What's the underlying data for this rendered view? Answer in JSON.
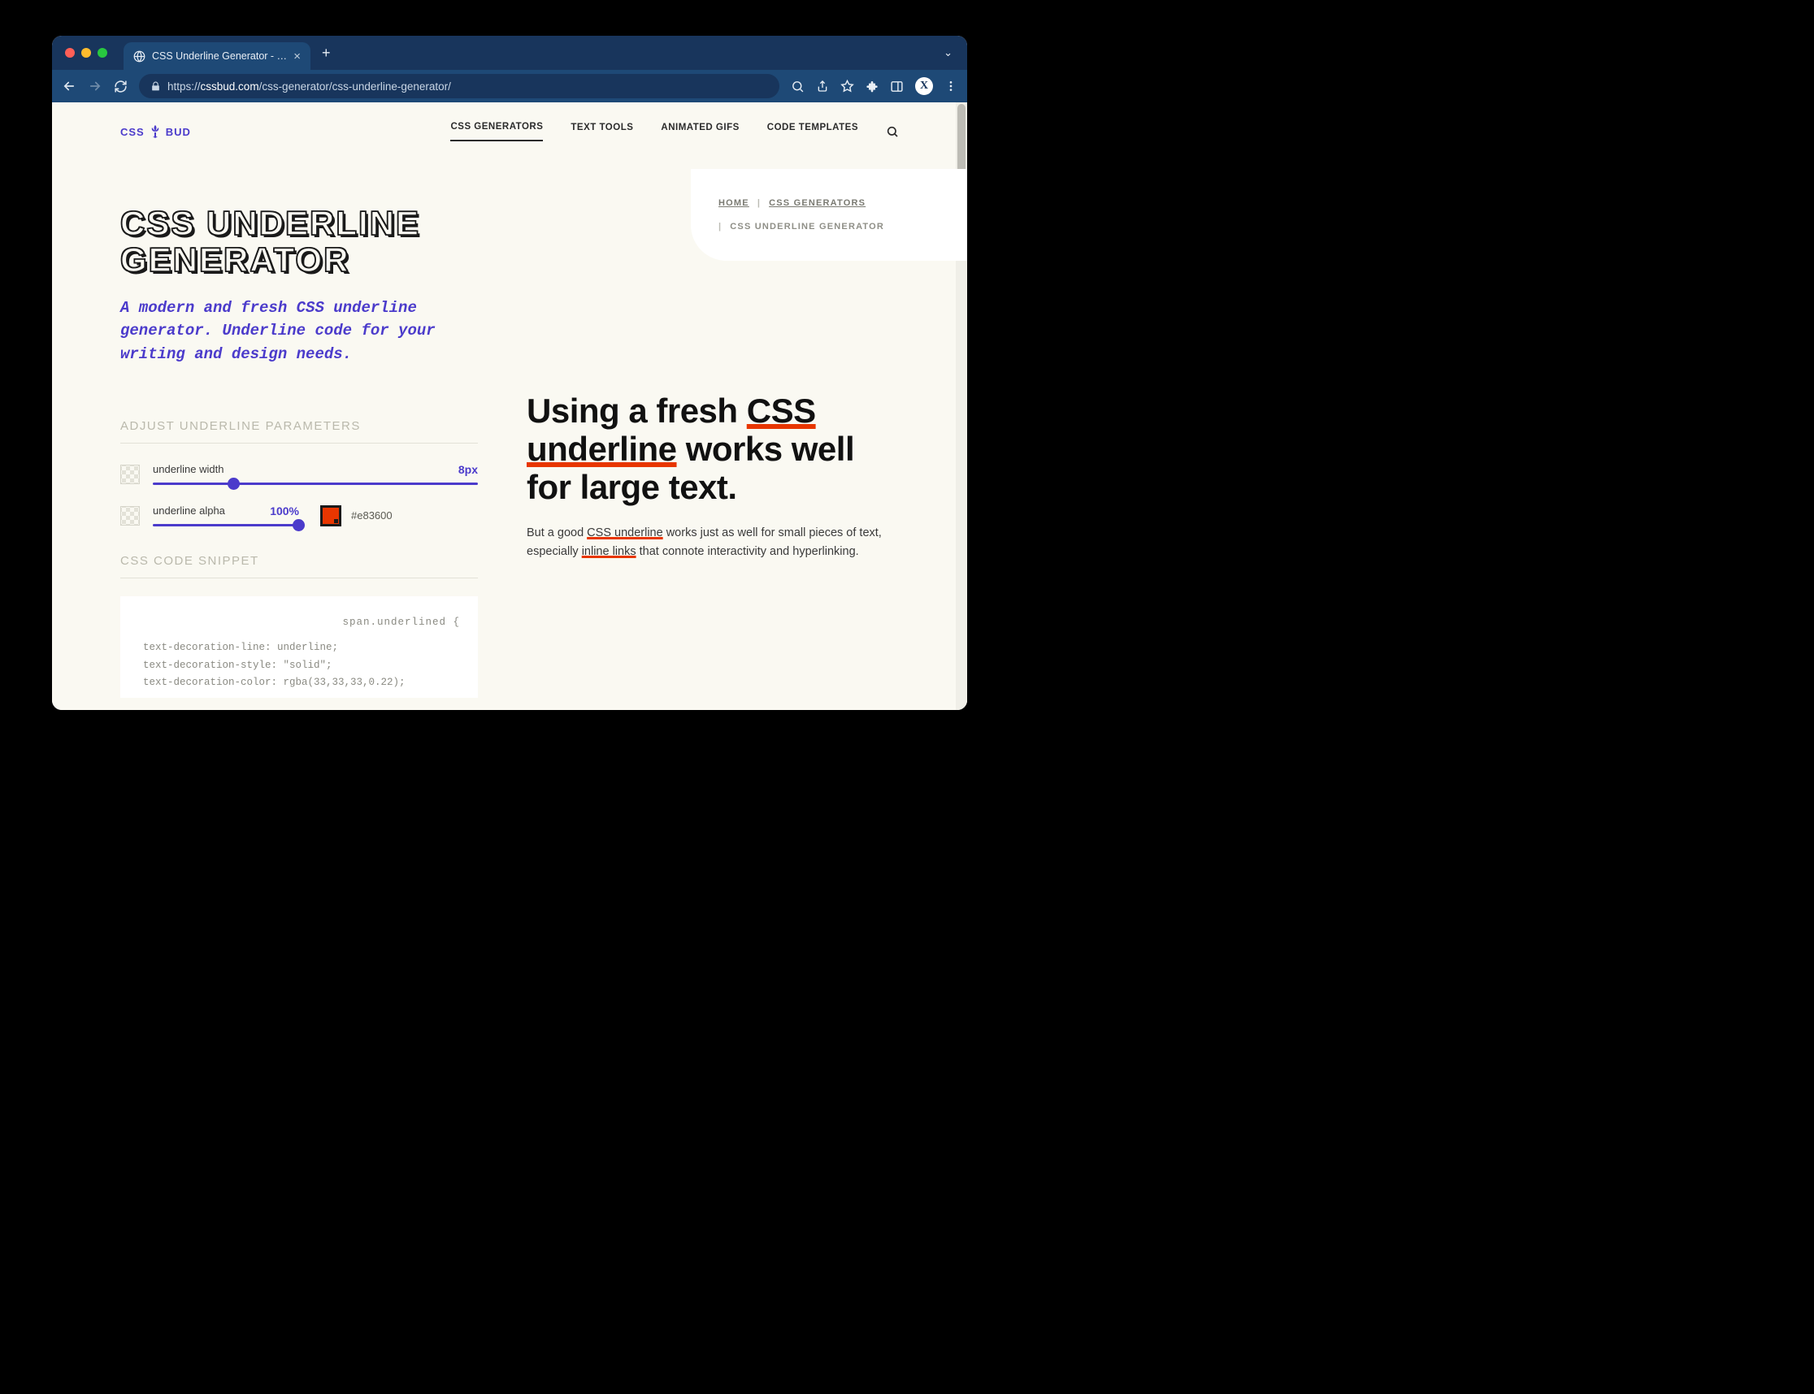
{
  "browser": {
    "tab_title": "CSS Underline Generator - CSS",
    "url_prefix": "https://",
    "url_host": "cssbud.com",
    "url_path": "/css-generator/css-underline-generator/"
  },
  "header": {
    "logo_left": "CSS",
    "logo_right": "BUD",
    "nav": [
      "CSS GENERATORS",
      "TEXT TOOLS",
      "ANIMATED GIFS",
      "CODE TEMPLATES"
    ]
  },
  "page": {
    "title": "CSS UNDERLINE GENERATOR",
    "subtitle": "A modern and fresh CSS underline generator. Underline code for your writing and design needs."
  },
  "breadcrumb": {
    "home": "HOME",
    "css_gen": "CSS GENERATORS",
    "current": "CSS UNDERLINE GENERATOR"
  },
  "params": {
    "section_label": "ADJUST UNDERLINE PARAMETERS",
    "width_label": "underline width",
    "width_value": "8px",
    "width_pct": 23,
    "alpha_label": "underline alpha",
    "alpha_value": "100%",
    "alpha_pct": 100,
    "color_hex": "#e83600"
  },
  "snippet": {
    "section_label": "CSS CODE SNIPPET",
    "selector": "span.underlined {",
    "line1": "text-decoration-line: underline;",
    "line2": "text-decoration-style: \"solid\";",
    "line3": "text-decoration-color: rgba(33,33,33,0.22);"
  },
  "demo": {
    "h_pre": "Using a fresh ",
    "h_u1": "CSS underline",
    "h_post": " works well for large text.",
    "p_pre": "But a good ",
    "p_u1": "CSS underline",
    "p_mid": " works just as well for small pieces of text, especially ",
    "p_u2": "inline links",
    "p_post": " that connote interactivity and hyperlinking."
  }
}
